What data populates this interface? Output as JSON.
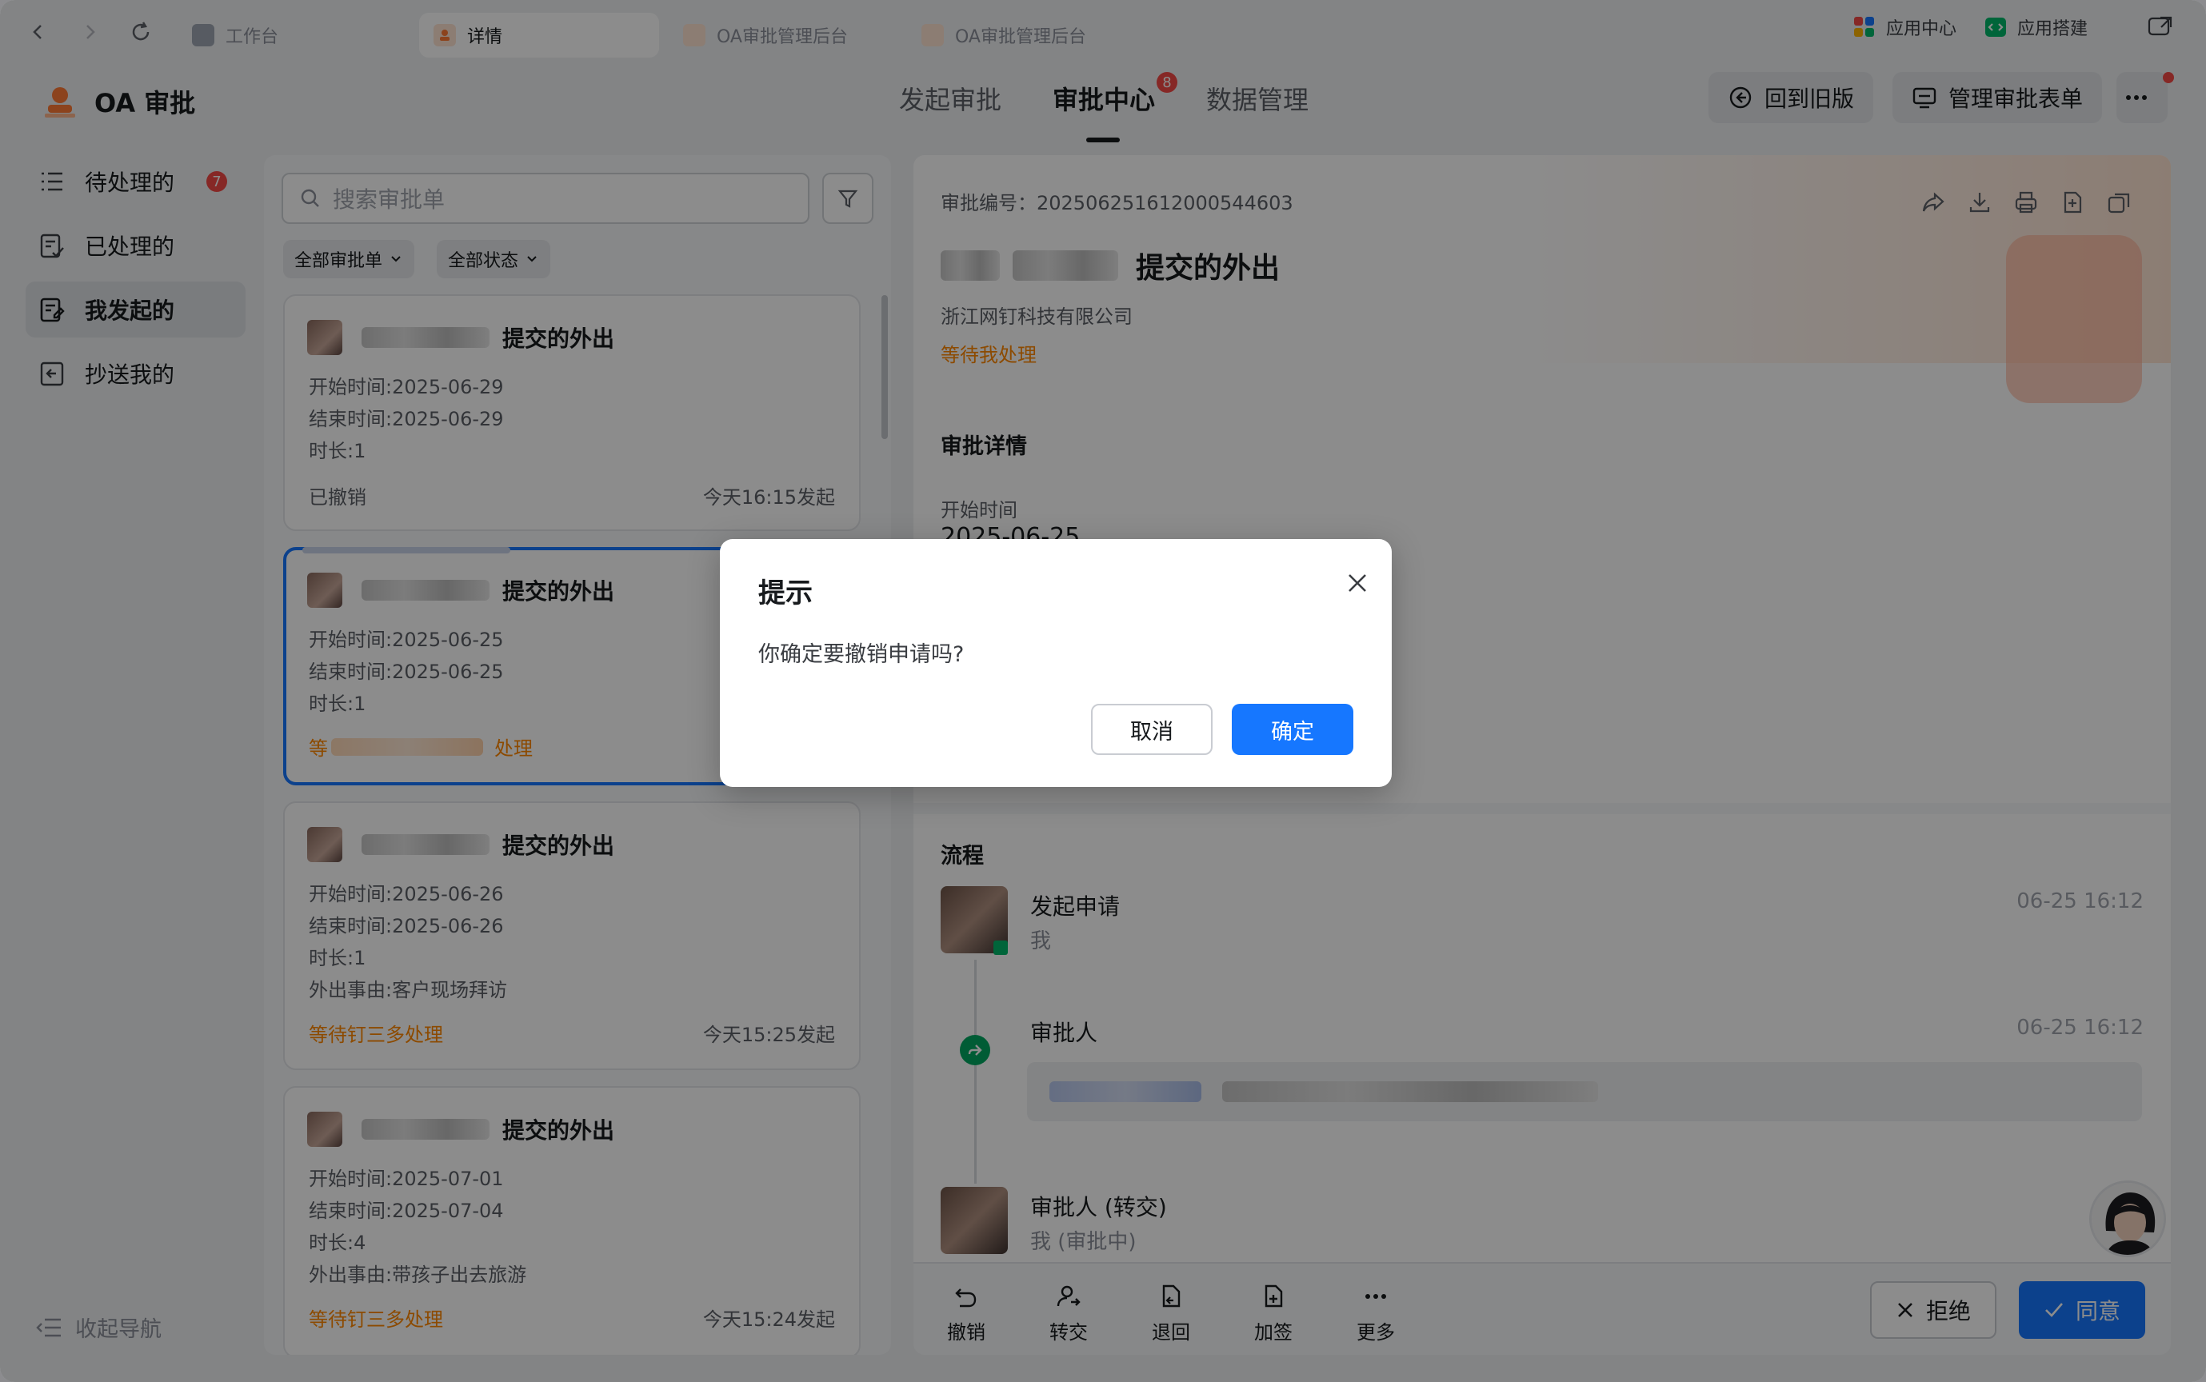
{
  "browser": {
    "tabs": [
      {
        "label": "工作台"
      },
      {
        "label": "详情"
      },
      {
        "label": "OA审批管理后台"
      },
      {
        "label": "OA审批管理后台"
      }
    ],
    "right_tools": {
      "app_center": "应用中心",
      "app_builder": "应用搭建"
    }
  },
  "header": {
    "app_title": "OA 审批",
    "nav": [
      {
        "label": "发起审批"
      },
      {
        "label": "审批中心",
        "badge": "8"
      },
      {
        "label": "数据管理"
      }
    ],
    "back_old": "回到旧版",
    "manage_forms": "管理审批表单"
  },
  "sidebar": {
    "items": [
      {
        "label": "待处理的",
        "badge": "7",
        "icon": "list-icon"
      },
      {
        "label": "已处理的",
        "icon": "done-doc-icon"
      },
      {
        "label": "我发起的",
        "icon": "submitted-doc-icon"
      },
      {
        "label": "抄送我的",
        "icon": "cc-icon"
      }
    ],
    "collapse": "收起导航"
  },
  "list": {
    "search_placeholder": "搜索审批单",
    "filter_type": "全部审批单",
    "filter_status": "全部状态",
    "cards": [
      {
        "title": "提交的外出",
        "start": "开始时间:2025-06-29",
        "end": "结束时间:2025-06-29",
        "duration": "时长:1",
        "status": "已撤销",
        "time": "今天16:15发起"
      },
      {
        "title": "提交的外出",
        "start": "开始时间:2025-06-25",
        "end": "结束时间:2025-06-25",
        "duration": "时长:1",
        "status_prefix": "等",
        "status_suffix": "处理"
      },
      {
        "title": "提交的外出",
        "start": "开始时间:2025-06-26",
        "end": "结束时间:2025-06-26",
        "duration": "时长:1",
        "reason": "外出事由:客户现场拜访",
        "status": "等待钉三多处理",
        "time": "今天15:25发起"
      },
      {
        "title": "提交的外出",
        "start": "开始时间:2025-07-01",
        "end": "结束时间:2025-07-04",
        "duration": "时长:4",
        "reason": "外出事由:带孩子出去旅游",
        "status": "等待钉三多处理",
        "time": "今天15:24发起"
      }
    ]
  },
  "detail": {
    "number": "审批编号：202506251612000544603",
    "title": "提交的外出",
    "company": "浙江网钉科技有限公司",
    "status": "等待我处理",
    "section": "审批详情",
    "field_label": "开始时间",
    "field_value": "2025-06-25",
    "flow": {
      "title": "流程",
      "steps": [
        {
          "name": "发起申请",
          "sub": "我",
          "time": "06-25 16:12"
        },
        {
          "name": "审批人",
          "time": "06-25 16:12"
        },
        {
          "name": "审批人 (转交)",
          "sub": "我 (审批中)"
        }
      ]
    },
    "actions": [
      {
        "label": "撤销"
      },
      {
        "label": "转交"
      },
      {
        "label": "退回"
      },
      {
        "label": "加签"
      },
      {
        "label": "更多"
      }
    ],
    "reject": "拒绝",
    "agree": "同意"
  },
  "dialog": {
    "title": "提示",
    "message": "你确定要撤销申请吗?",
    "cancel": "取消",
    "confirm": "确定"
  },
  "colors": {
    "primary": "#1677ff",
    "warning": "#ff8800",
    "badge": "#f54a45"
  }
}
